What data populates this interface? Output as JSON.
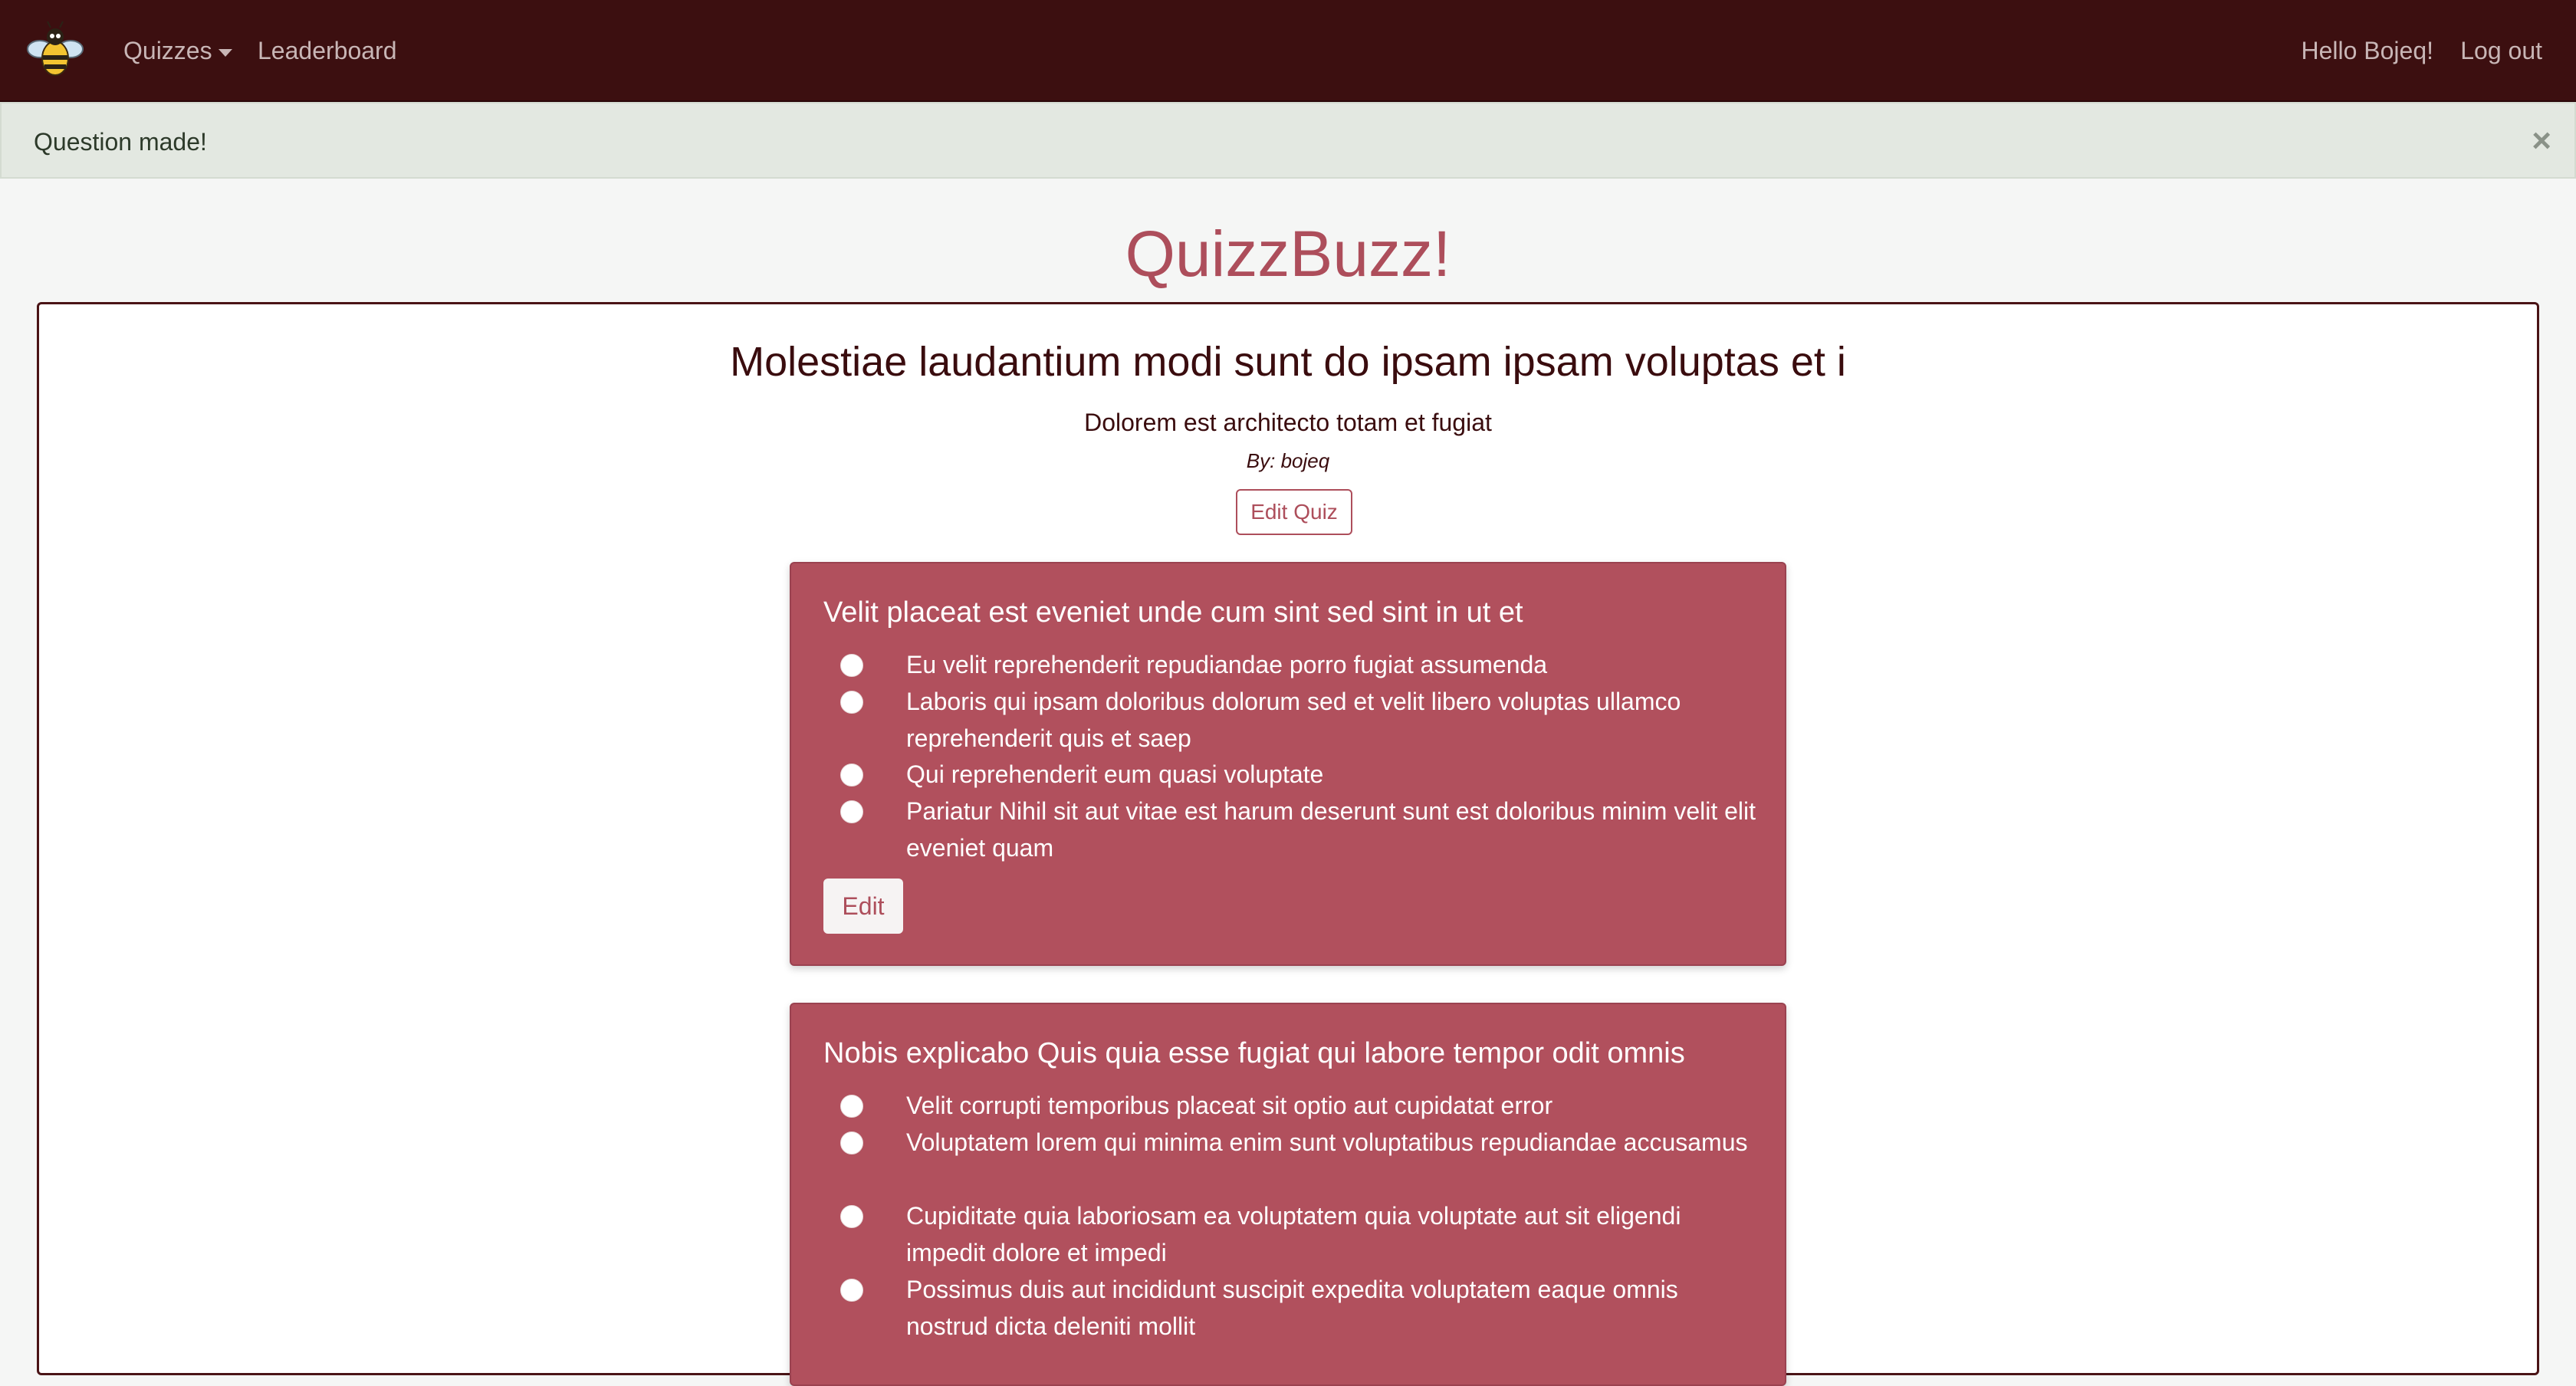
{
  "nav": {
    "logo": "bee-logo",
    "quizzes_label": "Quizzes",
    "leaderboard_label": "Leaderboard",
    "greeting": "Hello Bojeq!",
    "logout_label": "Log out"
  },
  "alert": {
    "message": "Question made!",
    "close_symbol": "×"
  },
  "brand": {
    "title": "QuizzBuzz!"
  },
  "quiz": {
    "title": "Molestiae laudantium modi sunt do ipsam ipsam voluptas et i",
    "description": "Dolorem est architecto totam et fugiat",
    "author": "By: bojeq",
    "edit_label": "Edit Quiz"
  },
  "questions": [
    {
      "title": "Velit placeat est eveniet unde cum sint sed sint in ut et",
      "options": [
        "Eu velit reprehenderit repudiandae porro fugiat assumenda",
        "Laboris qui ipsam doloribus dolorum sed et velit libero voluptas ullamco reprehenderit quis et saep",
        "Qui reprehenderit eum quasi voluptate",
        "Pariatur Nihil sit aut vitae est harum deserunt sunt est doloribus minim velit elit eveniet quam"
      ],
      "edit_label": "Edit"
    },
    {
      "title": "Nobis explicabo Quis quia esse fugiat qui labore tempor odit omnis",
      "options": [
        "Velit corrupti temporibus placeat sit optio aut cupidatat error",
        "Voluptatem lorem qui minima enim sunt voluptatibus repudiandae accusamus",
        "Cupiditate quia laboriosam ea voluptatem quia voluptate aut sit eligendi impedit dolore et impedi",
        "Possimus duis aut incididunt suscipit expedita voluptatem eaque omnis nostrud dicta deleniti mollit"
      ]
    }
  ],
  "colors": {
    "navbar": "#3c0f10",
    "accent": "#ad4e5b",
    "card": "#b1505d",
    "alert": "#e3e8e1"
  }
}
